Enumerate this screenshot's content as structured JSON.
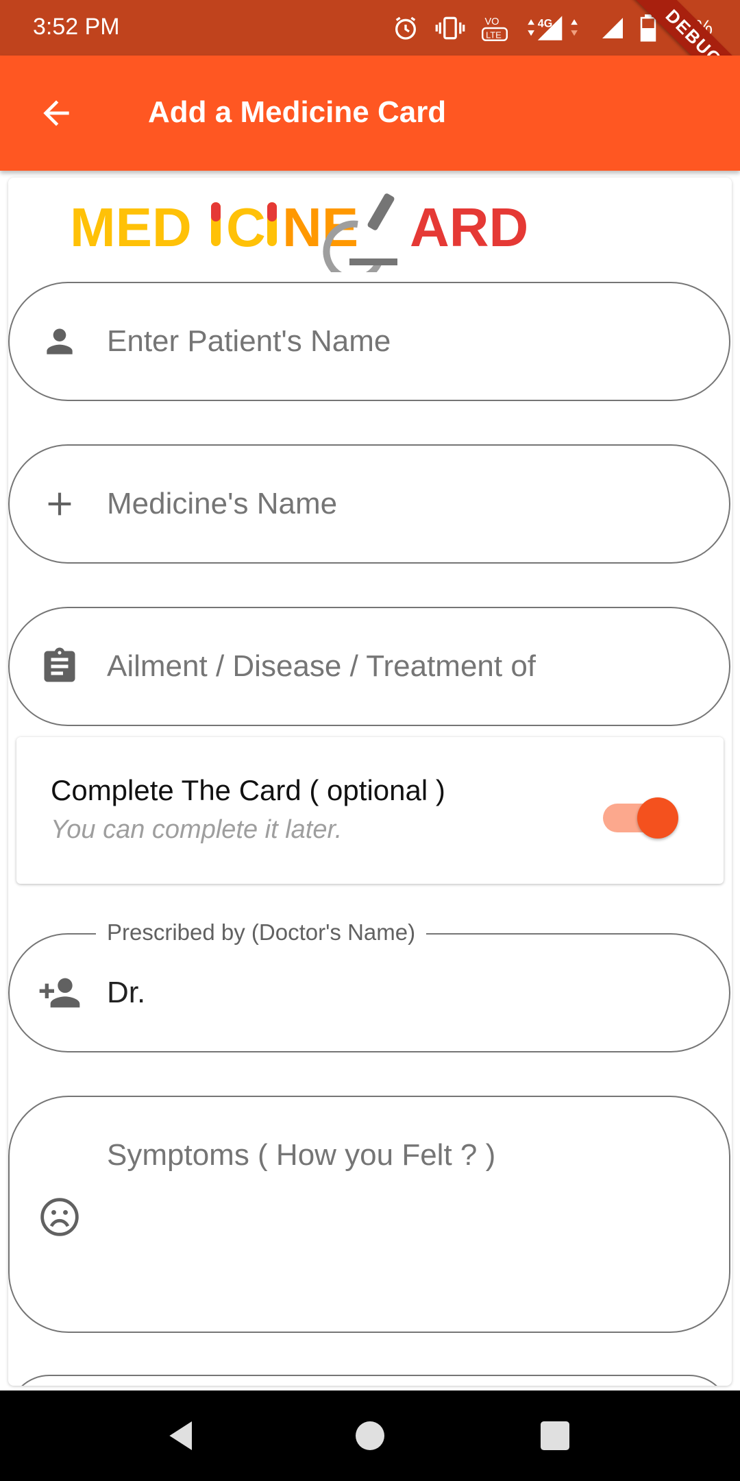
{
  "status_bar": {
    "time": "3:52 PM",
    "battery": "46%",
    "network": "4G",
    "debug_banner": "DEBUG",
    "icons": [
      "alarm-icon",
      "vibrate-icon",
      "volte-icon",
      "signal-icon",
      "battery-icon"
    ]
  },
  "app_bar": {
    "title": "Add a Medicine Card",
    "back_icon": "arrow-back-icon"
  },
  "logo": {
    "text_left": "MEDICINE",
    "text_right": "CARD"
  },
  "form": {
    "patient_name": {
      "placeholder": "Enter Patient's Name",
      "icon": "person-icon"
    },
    "medicine_name": {
      "placeholder": "Medicine's Name",
      "icon": "plus-icon"
    },
    "ailment": {
      "placeholder": "Ailment / Disease / Treatment of",
      "icon": "clipboard-icon"
    },
    "complete_card": {
      "title": "Complete The Card ( optional )",
      "subtitle": "You can complete it later.",
      "enabled": true
    },
    "doctor": {
      "label": "Prescribed by (Doctor's Name)",
      "value": "Dr.",
      "icon": "person-add-icon"
    },
    "symptoms": {
      "placeholder": "Symptoms ( How you Felt ? )",
      "icon": "sad-face-icon"
    }
  },
  "colors": {
    "primary": "#ff5722",
    "status_bar": "#c0431d",
    "switch_thumb": "#f4511e",
    "switch_track": "#fca88d"
  }
}
